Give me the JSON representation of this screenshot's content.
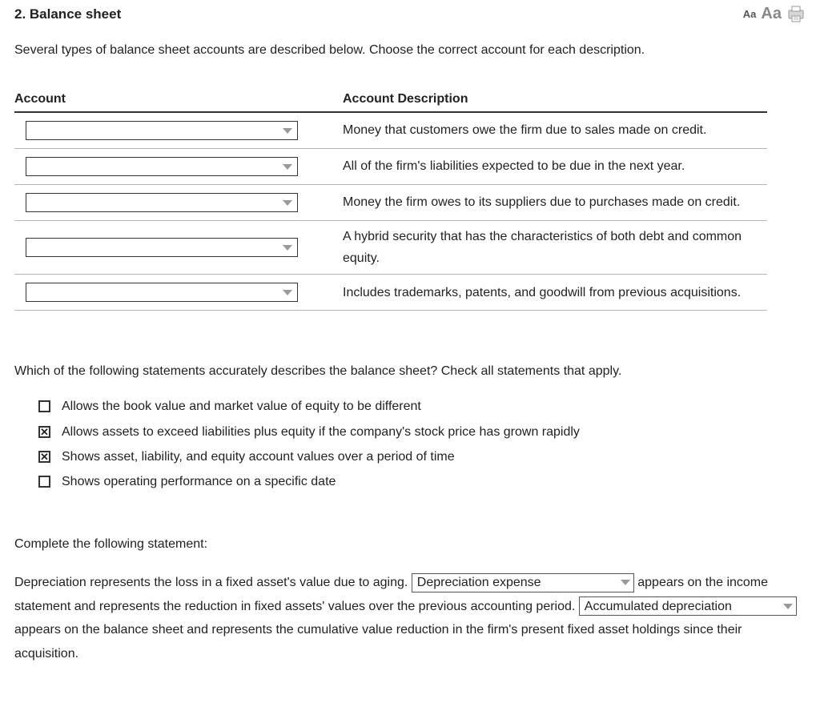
{
  "header": {
    "title": "2.  Balance sheet",
    "aa_small": "Aa",
    "aa_large": "Aa"
  },
  "intro": "Several types of balance sheet accounts are described below. Choose the correct account for each description.",
  "table": {
    "col_account": "Account",
    "col_description": "Account Description",
    "rows": [
      {
        "desc": "Money that customers owe the firm due to sales made on credit."
      },
      {
        "desc": "All of the firm's liabilities expected to be due in the next year."
      },
      {
        "desc": "Money the firm owes to its suppliers due to purchases made on credit."
      },
      {
        "desc": "A hybrid security that has the characteristics of both debt and common equity."
      },
      {
        "desc": "Includes trademarks, patents, and goodwill from previous acquisitions."
      }
    ]
  },
  "q2": {
    "prompt": "Which of the following statements accurately describes the balance sheet? Check all statements that apply.",
    "options": [
      {
        "checked": false,
        "text": "Allows the book value and market value of equity to be different"
      },
      {
        "checked": true,
        "text": "Allows assets to exceed liabilities plus equity if the company's stock price has grown rapidly"
      },
      {
        "checked": true,
        "text": "Shows asset, liability, and equity account values over a period of time"
      },
      {
        "checked": false,
        "text": "Shows operating performance on a specific date"
      }
    ]
  },
  "q3": {
    "heading": "Complete the following statement:",
    "p1a": "Depreciation represents the loss in a fixed asset's value due to aging. ",
    "sel1": "Depreciation expense",
    "p1b": " appears on the income statement and represents the reduction in fixed assets' values over the previous accounting period. ",
    "sel2": "Accumulated depreciation",
    "p1c": " appears on the balance sheet and represents the cumulative value reduction in the firm's present fixed asset holdings since their acquisition."
  }
}
